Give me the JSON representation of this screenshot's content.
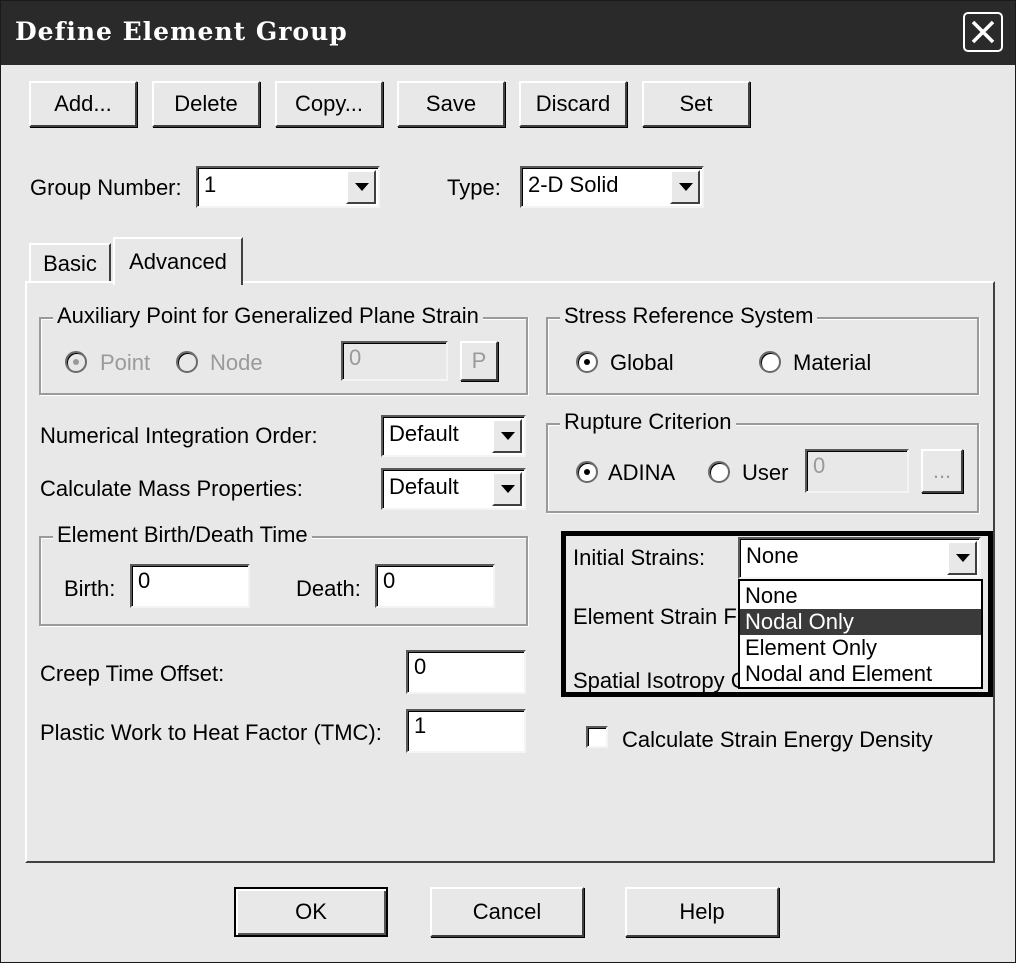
{
  "window": {
    "title": "Define Element Group"
  },
  "toolbar": {
    "add": "Add...",
    "delete": "Delete",
    "copy": "Copy...",
    "save": "Save",
    "discard": "Discard",
    "set": "Set"
  },
  "group_number": {
    "label": "Group Number:",
    "value": "1"
  },
  "type": {
    "label": "Type:",
    "value": "2-D Solid"
  },
  "tabs": [
    {
      "label": "Basic",
      "active": false
    },
    {
      "label": "Advanced",
      "active": true
    }
  ],
  "aux_point": {
    "title": "Auxiliary Point for Generalized Plane Strain",
    "point_label": "Point",
    "node_label": "Node",
    "value": "0",
    "p_button": "P",
    "selected": "Point",
    "enabled": false
  },
  "stress_ref": {
    "title": "Stress Reference System",
    "global_label": "Global",
    "material_label": "Material",
    "selected": "Global"
  },
  "integration_order": {
    "label": "Numerical Integration Order:",
    "value": "Default"
  },
  "mass_properties": {
    "label": "Calculate Mass Properties:",
    "value": "Default"
  },
  "rupture": {
    "title": "Rupture Criterion",
    "adina_label": "ADINA",
    "user_label": "User",
    "value": "0",
    "browse_button": "...",
    "selected": "ADINA"
  },
  "birth_death": {
    "title": "Element Birth/Death Time",
    "birth_label": "Birth:",
    "birth_value": "0",
    "death_label": "Death:",
    "death_value": "0"
  },
  "initial_strains": {
    "label": "Initial Strains:",
    "value": "None",
    "options": [
      "None",
      "Nodal Only",
      "Element Only",
      "Nodal and Element"
    ],
    "highlighted_option": "Nodal Only"
  },
  "element_strain_label": "Element Strain Fi",
  "spatial_isotropy_label": "Spatial Isotropy C",
  "creep_offset": {
    "label": "Creep Time Offset:",
    "value": "0"
  },
  "plastic_work": {
    "label": "Plastic Work to Heat Factor (TMC):",
    "value": "1"
  },
  "strain_energy": {
    "label": "Calculate Strain Energy Density",
    "checked": false
  },
  "footer": {
    "ok": "OK",
    "cancel": "Cancel",
    "help": "Help"
  },
  "colors": {
    "titlebar": "#2a2a2a",
    "face": "#e8e8e8",
    "selection": "#3a3a3a"
  }
}
